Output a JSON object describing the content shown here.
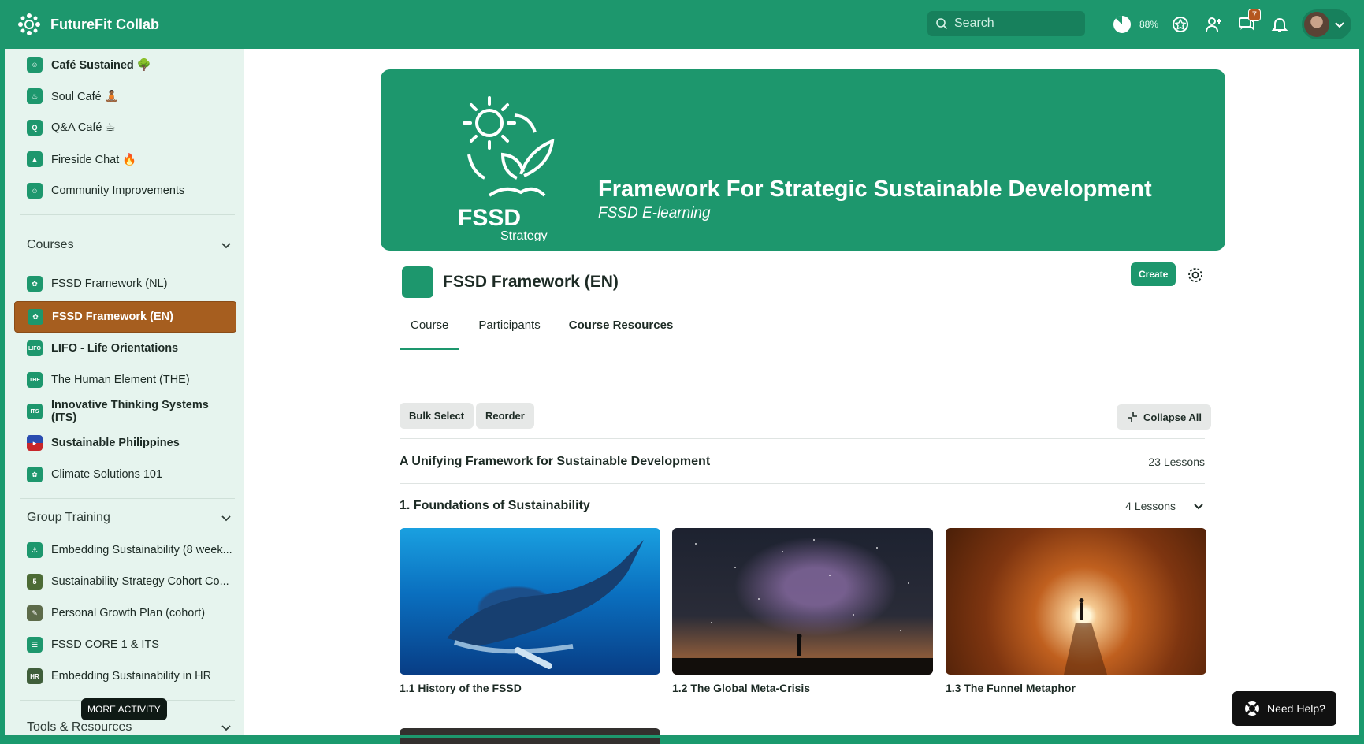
{
  "app": {
    "title": "FutureFit Collab"
  },
  "search": {
    "placeholder": "Search"
  },
  "topbar": {
    "progress_pct": "88%",
    "notifications_count": "7"
  },
  "sidebar": {
    "top_items": [
      {
        "label": "Café Sustained 🌳",
        "bold": true
      },
      {
        "label": "Soul Café 🧘🏾"
      },
      {
        "label": "Q&A Café ☕"
      },
      {
        "label": "Fireside Chat 🔥"
      },
      {
        "label": "Community Improvements"
      }
    ],
    "courses_heading": "Courses",
    "courses": [
      {
        "label": "FSSD Framework (NL)"
      },
      {
        "label": "FSSD Framework (EN)",
        "active": true
      },
      {
        "label": "LIFO - Life Orientations",
        "bold": true,
        "icon": "LIFO"
      },
      {
        "label": "The Human Element (THE)",
        "icon": "THE"
      },
      {
        "label": "Innovative Thinking Systems (ITS)",
        "bold": true,
        "icon": "ITS"
      },
      {
        "label": "Sustainable Philippines",
        "bold": true
      },
      {
        "label": "Climate Solutions 101"
      }
    ],
    "group_heading": "Group Training",
    "group": [
      {
        "label": "Embedding Sustainability (8 week..."
      },
      {
        "label": "Sustainability Strategy Cohort Co..."
      },
      {
        "label": "Personal Growth Plan (cohort)"
      },
      {
        "label": "FSSD CORE 1 & ITS"
      },
      {
        "label": "Embedding Sustainability in HR",
        "icon": "HR"
      }
    ],
    "tools_heading": "Tools & Resources",
    "more_activity": "MORE ACTIVITY"
  },
  "hero": {
    "logo_text": "FSSD",
    "logo_sub": "Strategy",
    "title": "Framework For Strategic Sustainable Development",
    "subtitle": "FSSD E-learning"
  },
  "course": {
    "title": "FSSD Framework (EN)",
    "create_label": "Create",
    "tabs": [
      "Course",
      "Participants",
      "Course Resources"
    ],
    "bulk_select": "Bulk Select",
    "reorder": "Reorder",
    "collapse_all": "Collapse All",
    "section_title": "A Unifying Framework for Sustainable Development",
    "section_count": "23 Lessons",
    "module_title": "1. Foundations of Sustainability",
    "module_count": "4 Lessons",
    "lessons": [
      "1.1 History of the FSSD",
      "1.2 The Global Meta-Crisis",
      "1.3 The Funnel Metaphor"
    ]
  },
  "help": {
    "label": "Need Help?"
  },
  "colors": {
    "brand": "#1d976d",
    "active": "#a65e1f"
  }
}
